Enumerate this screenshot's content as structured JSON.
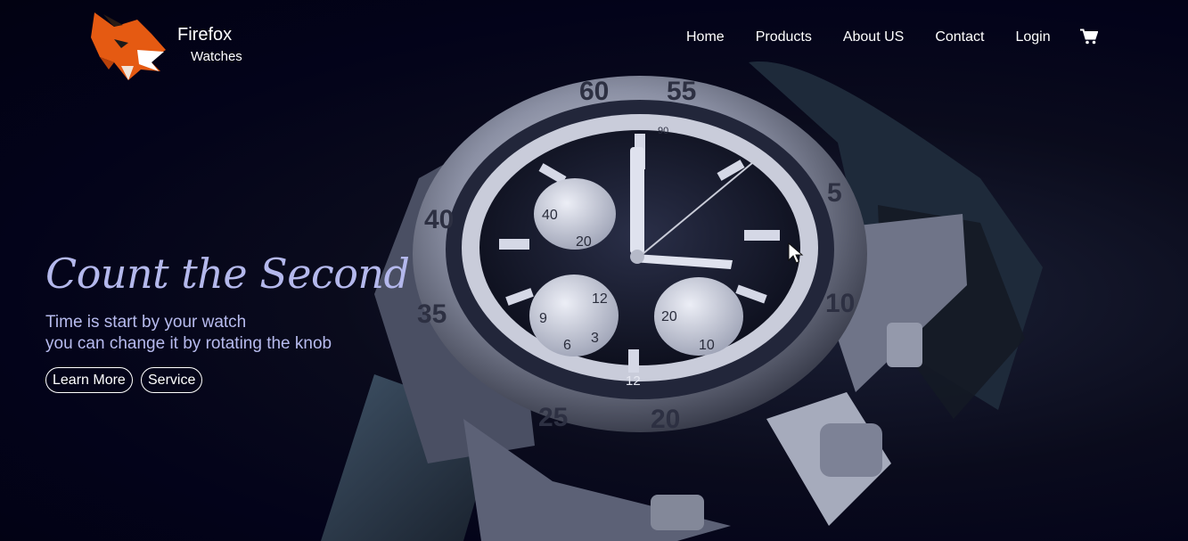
{
  "brand": {
    "name": "Firefox",
    "subtitle": "Watches"
  },
  "nav": {
    "items": [
      "Home",
      "Products",
      "About US",
      "Contact",
      "Login"
    ]
  },
  "hero": {
    "title": "Count the Second",
    "line1": "Time is start by your watch",
    "line2": "you can change it by rotating the knob",
    "buttons": {
      "learn_more": "Learn More",
      "service": "Service"
    }
  },
  "watch": {
    "bezel_numbers": [
      "60",
      "55",
      "5",
      "10",
      "20",
      "25",
      "35",
      "40"
    ],
    "subdial_top": [
      "40",
      "20"
    ],
    "subdial_left": [
      "9",
      "12",
      "6",
      "3"
    ],
    "subdial_right": [
      "20",
      "10"
    ],
    "date_marker": "12",
    "scale_mark": "90"
  },
  "colors": {
    "background": "#03031a",
    "title": "#b4b8ec",
    "logo_orange": "#e55a12"
  },
  "icons": {
    "cart": "cart-icon",
    "logo": "fox-logo-icon"
  }
}
